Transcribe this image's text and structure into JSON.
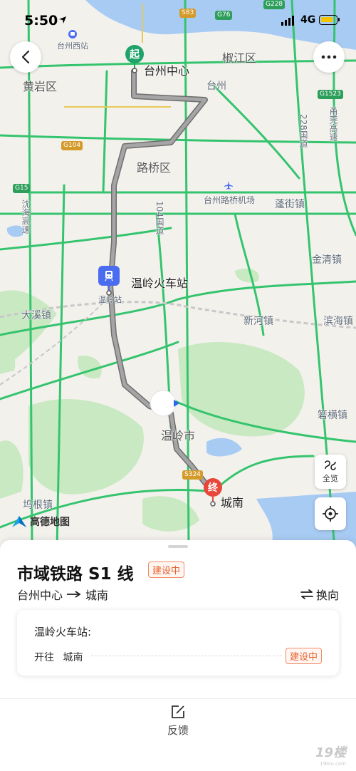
{
  "status_bar": {
    "time": "5:50",
    "network": "4G"
  },
  "map": {
    "labels": {
      "taizhou_west": "台州西站",
      "huangyan": "黄岩区",
      "jiaojiang": "椒江区",
      "taizhou": "台州",
      "luqiao": "路桥区",
      "airport": "台州路桥机场",
      "pengjie": "蓬街镇",
      "jinqing": "金清镇",
      "shenhai": "沈海高速",
      "nanqian": "甬莞高速",
      "g104": "104国道",
      "g228": "228国道",
      "daxi": "大溪镇",
      "xinhe": "新河镇",
      "binhai": "滨海镇",
      "wenling_city": "温岭市",
      "xiaqi": "箬横镇",
      "wugen": "坞根镇",
      "wenling_station_small": "温岭站"
    },
    "badges": {
      "s83": "S83",
      "g76": "G76",
      "g228": "G228",
      "g104": "G104",
      "g15": "G15",
      "g1523": "G1523",
      "s324": "S324"
    },
    "start_marker": {
      "label": "起",
      "name": "台州中心"
    },
    "station_marker": {
      "name": "温岭火车站"
    },
    "end_marker": {
      "label": "终",
      "name": "城南"
    },
    "logo_text": "高德地图",
    "overview_label": "全览",
    "colors": {
      "route": "#9a9a9a",
      "start": "#1fa36a",
      "end": "#e8483a",
      "station": "#4a6cf0",
      "road_green": "#35c46e"
    }
  },
  "sheet": {
    "title": "市域铁路 S1 线",
    "status_tag": "建设中",
    "route_from": "台州中心",
    "route_to": "城南",
    "swap_label": "换向",
    "card": {
      "station": "温岭火车站:",
      "direction_prefix": "开往",
      "direction_target": "城南",
      "status_tag": "建设中"
    },
    "feedback_label": "反馈"
  },
  "watermark": {
    "brand": "19楼",
    "url": "19lou.com"
  }
}
